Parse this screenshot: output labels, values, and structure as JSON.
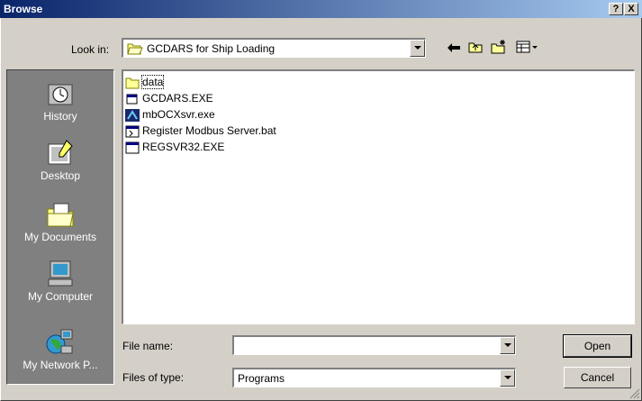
{
  "window": {
    "title": "Browse",
    "help_button": "?",
    "close_button": "X"
  },
  "look_in": {
    "label": "Look in:",
    "value": "GCDARS for Ship Loading"
  },
  "places": [
    {
      "label": "History",
      "icon": "history-icon"
    },
    {
      "label": "Desktop",
      "icon": "desktop-icon"
    },
    {
      "label": "My Documents",
      "icon": "my-documents-icon"
    },
    {
      "label": "My Computer",
      "icon": "my-computer-icon"
    },
    {
      "label": "My Network P...",
      "icon": "my-network-icon"
    }
  ],
  "files": [
    {
      "name": "data",
      "icon": "folder-icon"
    },
    {
      "name": "GCDARS.EXE",
      "icon": "exe-icon"
    },
    {
      "name": "mbOCXsvr.exe",
      "icon": "app-icon"
    },
    {
      "name": "Register Modbus Server.bat",
      "icon": "batch-icon"
    },
    {
      "name": "REGSVR32.EXE",
      "icon": "window-icon"
    }
  ],
  "file_name": {
    "label": "File name:",
    "value": ""
  },
  "files_of_type": {
    "label": "Files of type:",
    "value": "Programs"
  },
  "buttons": {
    "open": "Open",
    "cancel": "Cancel"
  },
  "colors": {
    "titlebar_start": "#0a246a",
    "titlebar_end": "#a6caf0",
    "face": "#d4d0c8",
    "places_bg": "#808080"
  }
}
